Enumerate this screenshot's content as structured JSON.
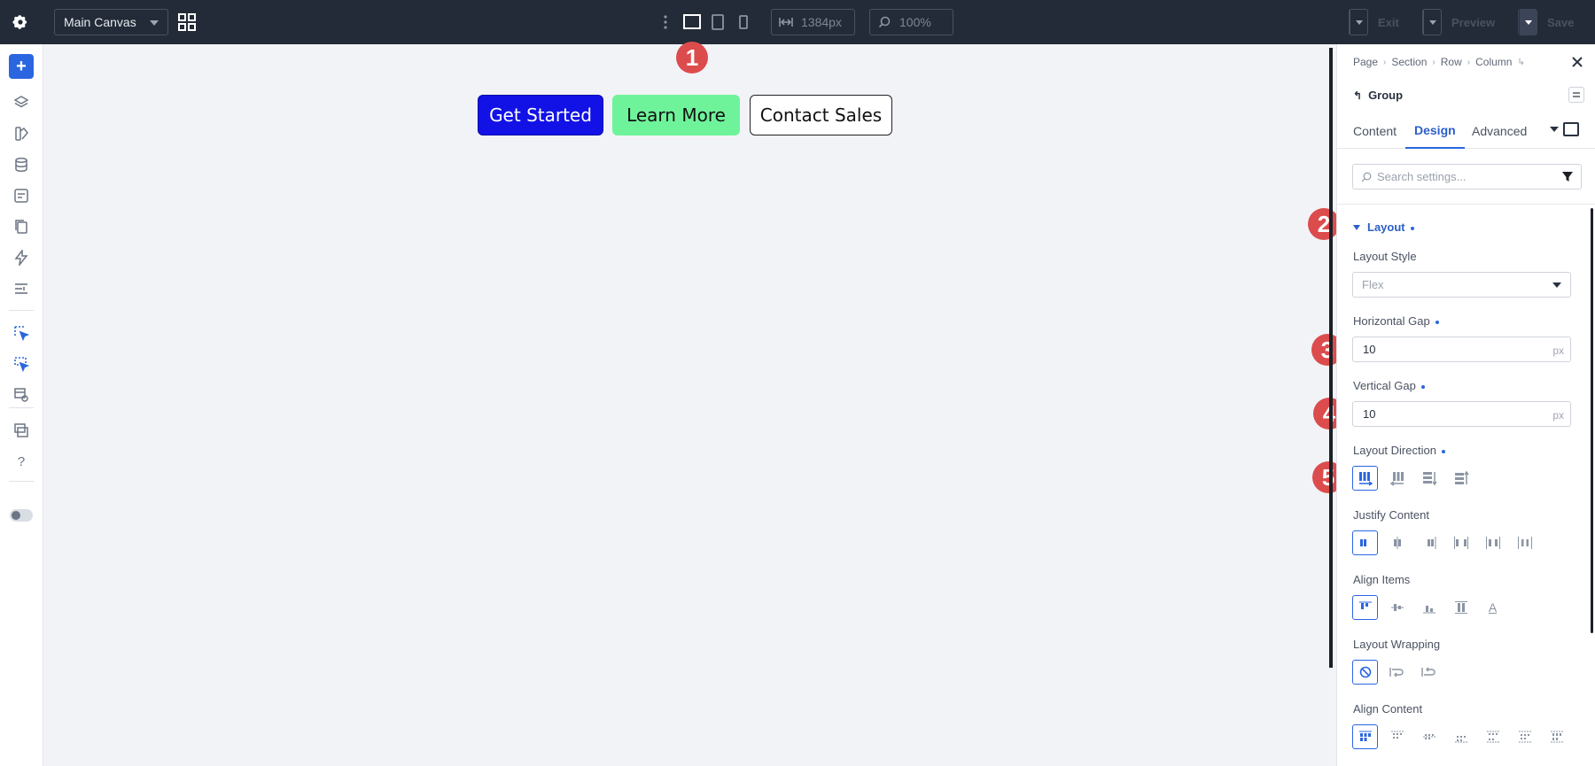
{
  "toolbar": {
    "canvas_select": "Main Canvas",
    "width_value": "1384px",
    "zoom_value": "100%",
    "exit_label": "Exit",
    "preview_label": "Preview",
    "save_label": "Save"
  },
  "canvas": {
    "buttons": [
      "Get Started",
      "Learn More",
      "Contact Sales"
    ]
  },
  "badges": [
    "1",
    "2",
    "3",
    "4",
    "5"
  ],
  "panel": {
    "breadcrumbs": [
      "Page",
      "Section",
      "Row",
      "Column"
    ],
    "element_title": "Group",
    "tabs": [
      "Content",
      "Design",
      "Advanced"
    ],
    "active_tab": "Design",
    "search_placeholder": "Search settings...",
    "section_title": "Layout",
    "layout_style_label": "Layout Style",
    "layout_style_value": "Flex",
    "horizontal_gap_label": "Horizontal Gap",
    "horizontal_gap_value": "10",
    "vertical_gap_label": "Vertical Gap",
    "vertical_gap_value": "10",
    "unit": "px",
    "layout_direction_label": "Layout Direction",
    "justify_content_label": "Justify Content",
    "align_items_label": "Align Items",
    "layout_wrapping_label": "Layout Wrapping",
    "align_content_label": "Align Content"
  },
  "colors": {
    "topbar": "#232b38",
    "accent": "#2b66e0",
    "badge": "#dc4c4c",
    "primary_button": "#1212e6",
    "secondary_button": "#6ff39a"
  }
}
